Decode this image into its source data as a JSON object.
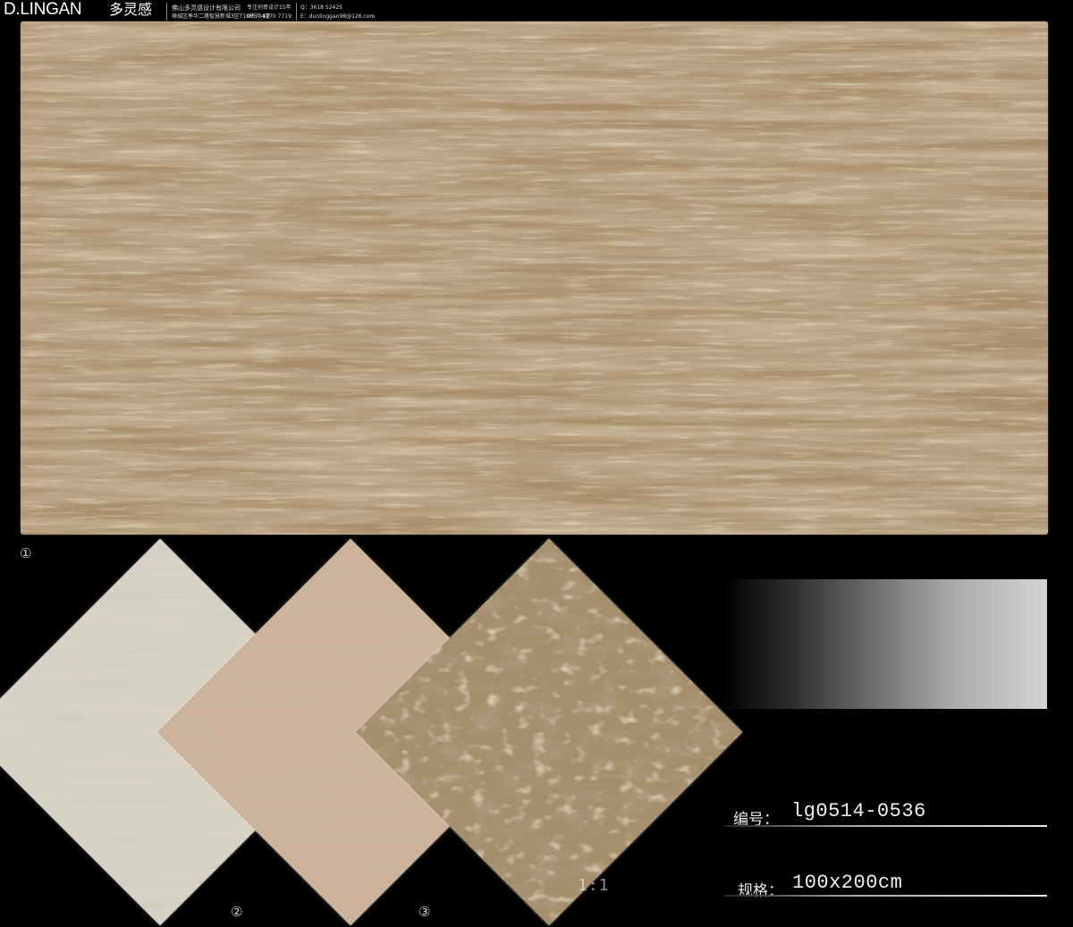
{
  "header": {
    "logo_latin": "D.LINGAN",
    "logo_cn": "多灵感",
    "company": "佛山多灵感设计有限公司",
    "address": "禅城区季华二路智慧新城3区T10栋704室",
    "slogan": "专注创意设计15年",
    "phone": "0757-8270 7719",
    "qq": "Q：3618 52425",
    "email": "E：dunlinggan98@126.com"
  },
  "markers": {
    "main": "①",
    "swatch2": "②",
    "swatch3": "③"
  },
  "scale_mark": "1:1",
  "info": {
    "code_label": "编号：",
    "code_value": "lg0514-0536",
    "size_label": "规格：",
    "size_value": "100x200cm"
  },
  "colors": {
    "main_tile_base": "#a88d68",
    "swatch1_base": "#d7d2c4",
    "swatch2_base": "#cdb39a",
    "swatch3_base": "#a58e6c",
    "background": "#000000"
  }
}
